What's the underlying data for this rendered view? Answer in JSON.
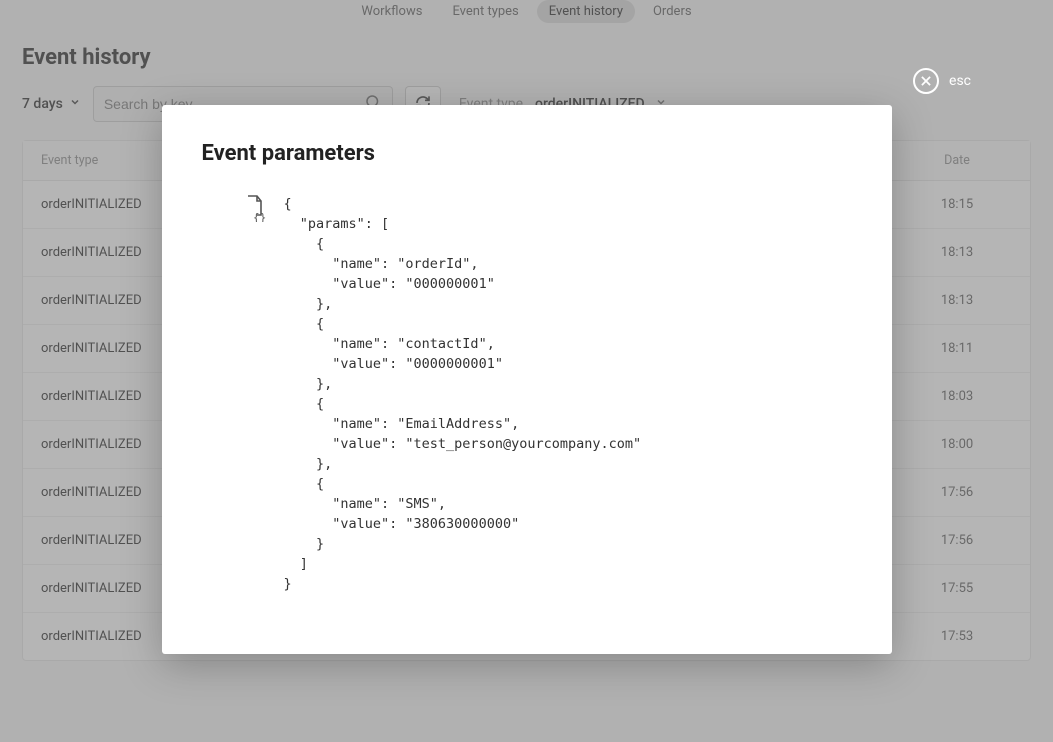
{
  "nav": {
    "workflows": "Workflows",
    "event_types": "Event types",
    "event_history": "Event history",
    "orders": "Orders"
  },
  "page_title": "Event history",
  "controls": {
    "range": "7 days",
    "search_placeholder": "Search by key",
    "filter_label": "Event type",
    "filter_value": "orderINITIALIZED"
  },
  "table": {
    "head_event": "Event type",
    "head_date": "Date",
    "rows": [
      {
        "event": "orderINITIALIZED",
        "date": "18:15"
      },
      {
        "event": "orderINITIALIZED",
        "date": "18:13"
      },
      {
        "event": "orderINITIALIZED",
        "date": "18:13"
      },
      {
        "event": "orderINITIALIZED",
        "date": "18:11"
      },
      {
        "event": "orderINITIALIZED",
        "date": "18:03"
      },
      {
        "event": "orderINITIALIZED",
        "date": "18:00"
      },
      {
        "event": "orderINITIALIZED",
        "date": "17:56"
      },
      {
        "event": "orderINITIALIZED",
        "date": "17:56"
      },
      {
        "event": "orderINITIALIZED",
        "date": "17:55"
      },
      {
        "event": "orderINITIALIZED",
        "date": "17:53"
      }
    ]
  },
  "modal": {
    "title": "Event parameters",
    "close_label": "esc",
    "code": "{\n  \"params\": [\n    {\n      \"name\": \"orderId\",\n      \"value\": \"000000001\"\n    },\n    {\n      \"name\": \"contactId\",\n      \"value\": \"0000000001\"\n    },\n    {\n      \"name\": \"EmailAddress\",\n      \"value\": \"test_person@yourcompany.com\"\n    },\n    {\n      \"name\": \"SMS\",\n      \"value\": \"380630000000\"\n    }\n  ]\n}"
  }
}
